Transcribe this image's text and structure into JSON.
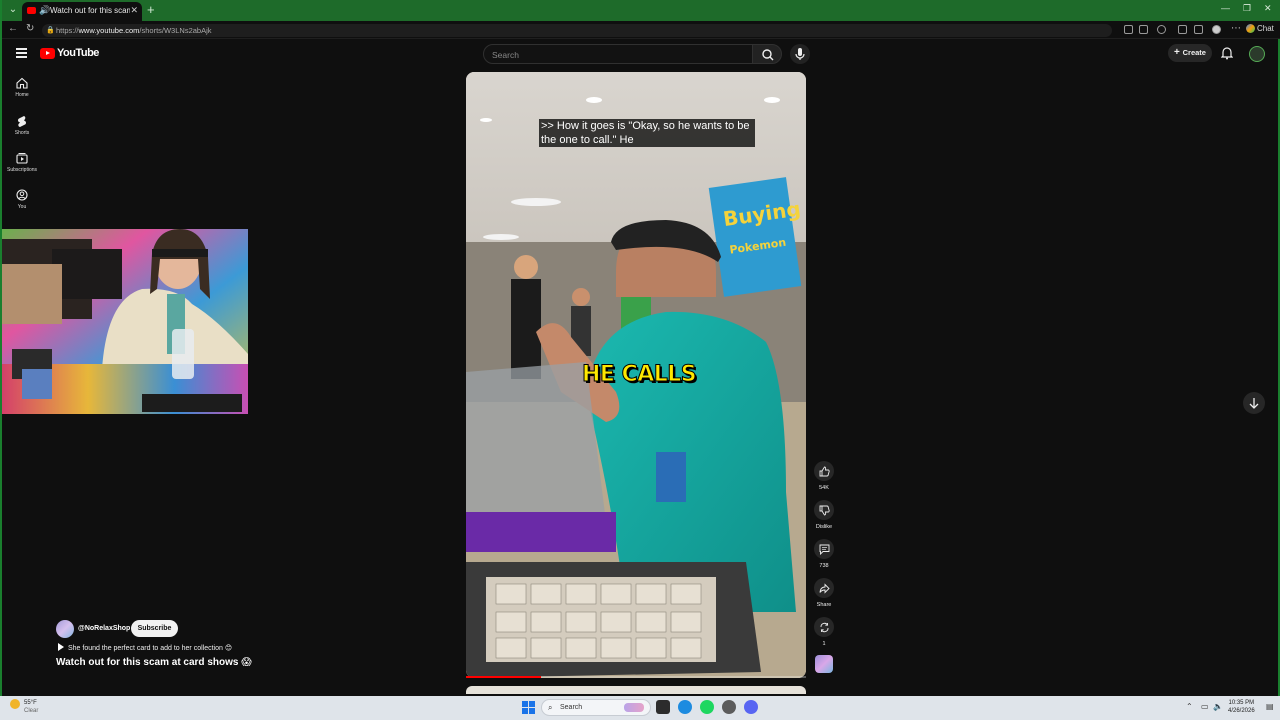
{
  "browser": {
    "tab_title": "Watch out for this scam at ca",
    "url_prefix": "https://",
    "url_host": "www.youtube.com",
    "url_path": "/shorts/W3LNs2abAjk",
    "chat_label": "Chat"
  },
  "header": {
    "logo_text": "YouTube",
    "search_placeholder": "Search",
    "create_label": "Create"
  },
  "sidebar": {
    "items": [
      {
        "label": "Home",
        "icon": "home-icon"
      },
      {
        "label": "Shorts",
        "icon": "shorts-icon"
      },
      {
        "label": "Subscriptions",
        "icon": "subscriptions-icon"
      },
      {
        "label": "You",
        "icon": "you-icon"
      }
    ]
  },
  "video": {
    "caption": ">> How it goes is \"Okay, so he wants to be the one to call.\" He",
    "burned_in_text": "HE CALLS",
    "progress": 0.22
  },
  "actions": {
    "like_count": "54K",
    "dislike_label": "Dislike",
    "comment_count": "738",
    "share_label": "Share",
    "remix_count": "1"
  },
  "channel": {
    "handle": "@NoRelaxShop",
    "subscribe_label": "Subscribe",
    "description": "She found the perfect card to add to her collection 😊",
    "title": "Watch out for this scam at card shows 😱"
  },
  "taskbar": {
    "weather_temp": "55°F",
    "weather_cond": "Clear",
    "search_label": "Search",
    "time": "10:35 PM",
    "date": "4/26/2026"
  },
  "colors": {
    "accent_green": "#1a7f2e",
    "youtube_red": "#ff0000",
    "caption_yellow": "#ffe800"
  }
}
